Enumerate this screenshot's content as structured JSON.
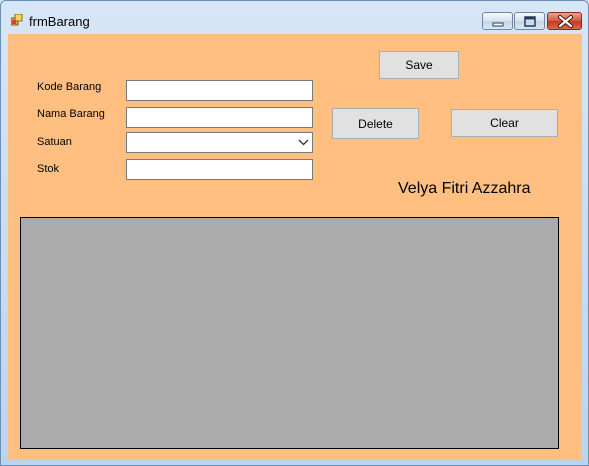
{
  "window": {
    "title": "frmBarang",
    "colors": {
      "client_background": "#ffbf80",
      "grid_background": "#ababab"
    }
  },
  "form": {
    "fields": [
      {
        "label": "Kode Barang",
        "value": ""
      },
      {
        "label": "Nama Barang",
        "value": ""
      },
      {
        "label": "Satuan",
        "value": ""
      },
      {
        "label": "Stok",
        "value": ""
      }
    ]
  },
  "buttons": {
    "save": "Save",
    "delete": "Delete",
    "clear": "Clear"
  },
  "author_label": "Velya Fitri Azzahra",
  "icons": {
    "app": "app-icon",
    "minimize": "minimize-icon",
    "maximize": "maximize-icon",
    "close": "close-icon",
    "dropdown": "chevron-down-icon"
  }
}
